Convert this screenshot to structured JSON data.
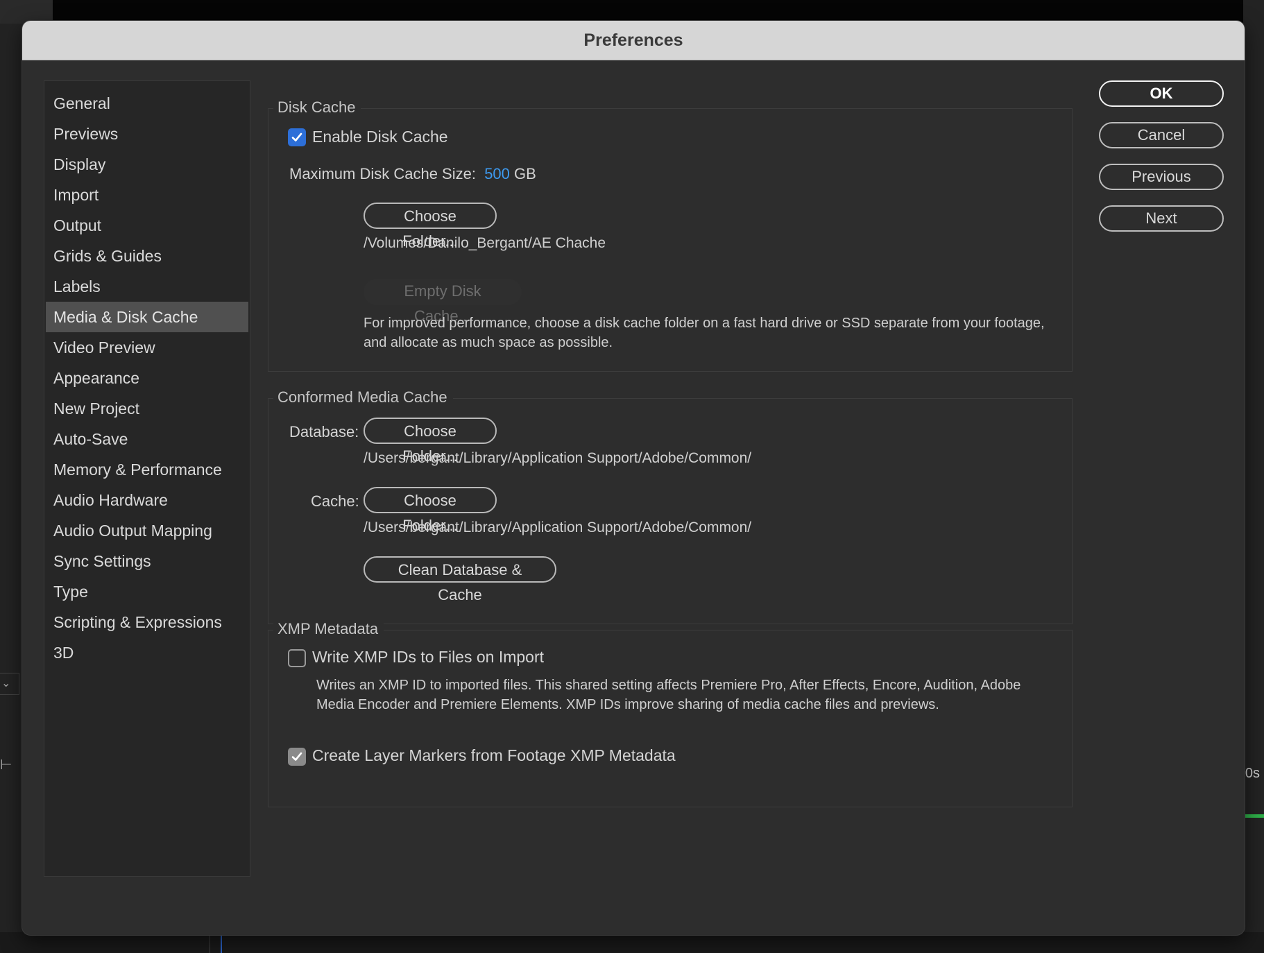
{
  "dialog": {
    "title": "Preferences"
  },
  "sidebar": {
    "items": [
      {
        "label": "General"
      },
      {
        "label": "Previews"
      },
      {
        "label": "Display"
      },
      {
        "label": "Import"
      },
      {
        "label": "Output"
      },
      {
        "label": "Grids & Guides"
      },
      {
        "label": "Labels"
      },
      {
        "label": "Media & Disk Cache"
      },
      {
        "label": "Video Preview"
      },
      {
        "label": "Appearance"
      },
      {
        "label": "New Project"
      },
      {
        "label": "Auto-Save"
      },
      {
        "label": "Memory & Performance"
      },
      {
        "label": "Audio Hardware"
      },
      {
        "label": "Audio Output Mapping"
      },
      {
        "label": "Sync Settings"
      },
      {
        "label": "Type"
      },
      {
        "label": "Scripting & Expressions"
      },
      {
        "label": "3D"
      }
    ],
    "selected": "Media & Disk Cache"
  },
  "disk_cache": {
    "legend": "Disk Cache",
    "enable_label": "Enable Disk Cache",
    "enabled": true,
    "max_size_label": "Maximum Disk Cache Size:",
    "max_size_value": "500",
    "max_size_unit": "GB",
    "choose_folder_label": "Choose Folder...",
    "folder_path": "/Volumes/Danilo_Bergant/AE Chache",
    "empty_cache_label": "Empty Disk Cache...",
    "hint": "For improved performance, choose a disk cache folder on a fast hard drive or SSD separate from your footage, and allocate as much space as possible."
  },
  "conformed_media_cache": {
    "legend": "Conformed Media Cache",
    "database_label": "Database:",
    "database_button": "Choose Folder...",
    "database_path": "/Users/bergant/Library/Application Support/Adobe/Common/",
    "cache_label": "Cache:",
    "cache_button": "Choose Folder...",
    "cache_path": "/Users/bergant/Library/Application Support/Adobe/Common/",
    "clean_label": "Clean Database & Cache"
  },
  "xmp_metadata": {
    "legend": "XMP Metadata",
    "write_ids_label": "Write XMP IDs to Files on Import",
    "write_ids_checked": false,
    "write_ids_hint": "Writes an XMP ID to imported files. This shared setting affects Premiere Pro, After Effects, Encore, Audition, Adobe Media Encoder and Premiere Elements. XMP IDs improve sharing of media cache files and previews.",
    "layer_markers_label": "Create Layer Markers from Footage XMP Metadata",
    "layer_markers_checked": true
  },
  "actions": {
    "ok": "OK",
    "cancel": "Cancel",
    "previous": "Previous",
    "next": "Next"
  },
  "background": {
    "timeline_label": "0s",
    "colors": {
      "accent": "#2d6fd8",
      "value_blue": "#3e9bf1",
      "timeline_green": "#2fb14a"
    }
  }
}
